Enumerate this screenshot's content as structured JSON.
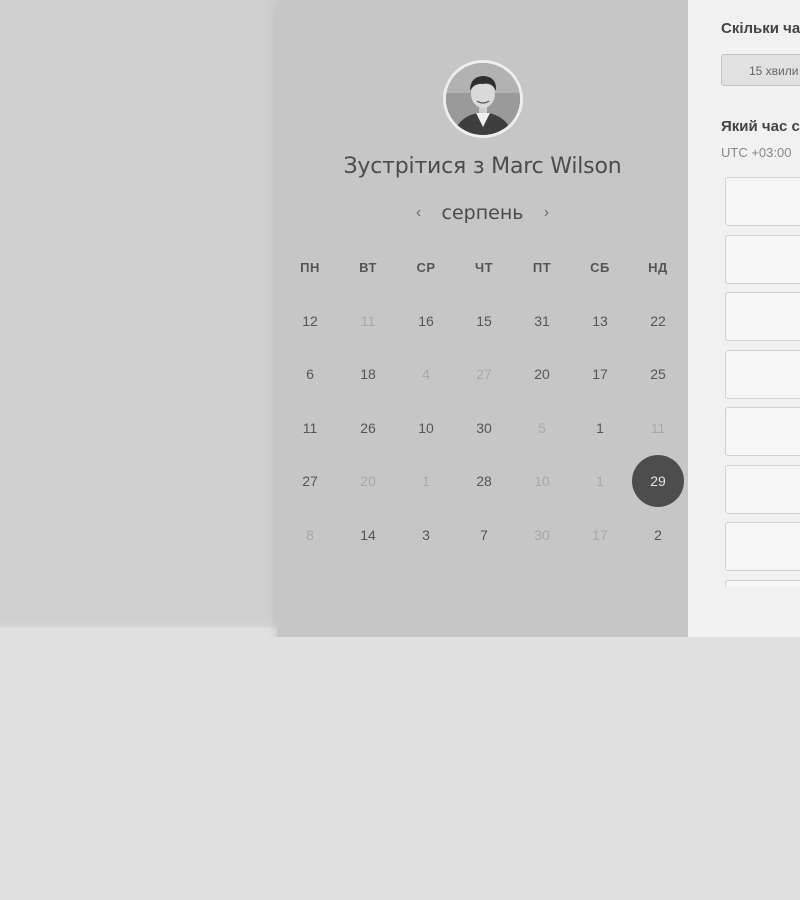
{
  "booking": {
    "title": "Зустрітися з Marc Wilson",
    "month": "серпень",
    "prev_symbol": "‹",
    "next_symbol": "›"
  },
  "calendar": {
    "weekdays": [
      "ПН",
      "ВТ",
      "СР",
      "ЧТ",
      "ПТ",
      "СБ",
      "НД"
    ],
    "rows": [
      [
        {
          "d": "12",
          "m": false
        },
        {
          "d": "11",
          "m": true
        },
        {
          "d": "16",
          "m": false
        },
        {
          "d": "15",
          "m": false
        },
        {
          "d": "31",
          "m": false
        },
        {
          "d": "13",
          "m": false
        },
        {
          "d": "22",
          "m": false
        }
      ],
      [
        {
          "d": "6",
          "m": false
        },
        {
          "d": "18",
          "m": false
        },
        {
          "d": "4",
          "m": true
        },
        {
          "d": "27",
          "m": true
        },
        {
          "d": "20",
          "m": false
        },
        {
          "d": "17",
          "m": false
        },
        {
          "d": "25",
          "m": false
        }
      ],
      [
        {
          "d": "11",
          "m": false
        },
        {
          "d": "26",
          "m": false
        },
        {
          "d": "10",
          "m": false
        },
        {
          "d": "30",
          "m": false
        },
        {
          "d": "5",
          "m": true
        },
        {
          "d": "1",
          "m": false
        },
        {
          "d": "11",
          "m": true
        }
      ],
      [
        {
          "d": "27",
          "m": false
        },
        {
          "d": "20",
          "m": true
        },
        {
          "d": "1",
          "m": true
        },
        {
          "d": "28",
          "m": false
        },
        {
          "d": "10",
          "m": true
        },
        {
          "d": "1",
          "m": true
        },
        {
          "d": "29",
          "m": false,
          "selected": true
        }
      ],
      [
        {
          "d": "8",
          "m": true
        },
        {
          "d": "14",
          "m": false
        },
        {
          "d": "3",
          "m": false
        },
        {
          "d": "7",
          "m": false
        },
        {
          "d": "30",
          "m": true
        },
        {
          "d": "17",
          "m": true
        },
        {
          "d": "2",
          "m": false
        }
      ]
    ]
  },
  "right_panel": {
    "duration_question": "Скільки ча",
    "duration_option": "15 хвили",
    "time_question": "Який час с",
    "timezone": "UTC +03:00"
  },
  "colors": {
    "selected_day": "#4d4d4d",
    "panel": "#c6c6c6",
    "right_panel": "#f1f1f1"
  }
}
